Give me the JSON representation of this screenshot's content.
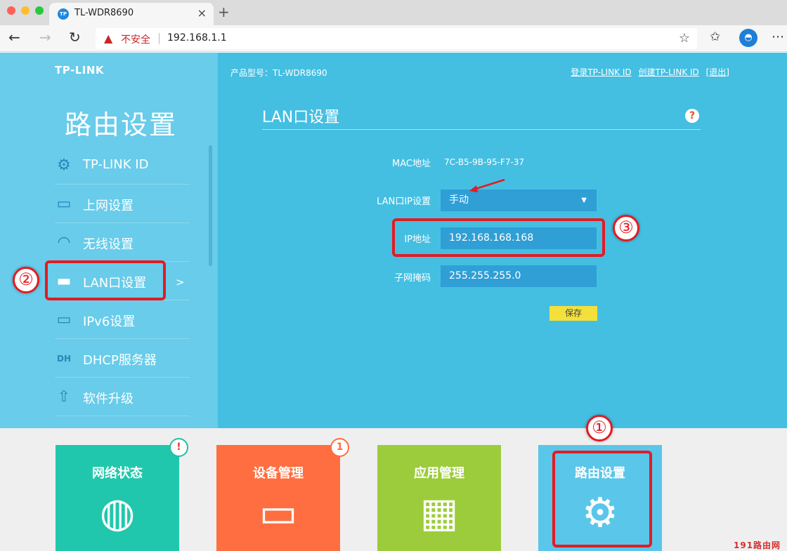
{
  "browser": {
    "tab_title": "TL-WDR8690",
    "tab_favicon": "TP",
    "tab_close": "×",
    "new_tab": "+",
    "insecure_label": "不安全",
    "url": "192.168.1.1",
    "back": "←",
    "forward": "→",
    "reload": "↻",
    "star": "☆",
    "favorites": "✩",
    "more": "⋯"
  },
  "router": {
    "logo": "TP-LINK",
    "model": "产品型号：TL-WDR8690",
    "top_links": [
      "登录TP-LINK ID",
      "创建TP-LINK ID",
      "[退出]"
    ],
    "sidebar_title": "路由设置",
    "menu": [
      {
        "label": "TP-LINK ID",
        "icon": "gear-icon",
        "glyph": "⚙"
      },
      {
        "label": "上网设置",
        "icon": "laptop-icon",
        "glyph": "▭"
      },
      {
        "label": "无线设置",
        "icon": "wifi-icon",
        "glyph": "◠"
      },
      {
        "label": "LAN口设置",
        "icon": "lan-port-icon",
        "glyph": "▬"
      },
      {
        "label": "IPv6设置",
        "icon": "laptop-icon",
        "glyph": "▭"
      },
      {
        "label": "DHCP服务器",
        "icon": "dhcp-icon",
        "glyph": "DH"
      },
      {
        "label": "软件升级",
        "icon": "upload-icon",
        "glyph": "⇧"
      }
    ],
    "menu_arrow": ">",
    "section_title": "LAN口设置",
    "help": "?",
    "form": {
      "mac_label": "MAC地址",
      "mac_value": "7C-B5-9B-95-F7-37",
      "lan_ip_mode_label": "LAN口IP设置",
      "lan_ip_mode_value": "手动",
      "ip_label": "IP地址",
      "ip_value": "192.168.168.168",
      "mask_label": "子网掩码",
      "mask_value": "255.255.255.0",
      "save": "保存"
    }
  },
  "tiles": [
    {
      "label": "网络状态",
      "icon": "globe-icon",
      "glyph": "◍",
      "color": "#21c7ad",
      "badge": "!",
      "badge_color": "#e53935"
    },
    {
      "label": "设备管理",
      "icon": "laptop-wifi-icon",
      "glyph": "▭",
      "color": "#ff6e40",
      "badge": "1",
      "badge_color": "#ff6e40"
    },
    {
      "label": "应用管理",
      "icon": "apps-grid-icon",
      "glyph": "▦",
      "color": "#9ccc3c",
      "badge": "",
      "badge_color": ""
    },
    {
      "label": "路由设置",
      "icon": "gear-icon",
      "glyph": "⚙",
      "color": "#5ac6ea",
      "badge": "",
      "badge_color": ""
    }
  ],
  "annotations": {
    "step1": "①",
    "step2": "②",
    "step3": "③",
    "watermark": "191路由网"
  },
  "colors": {
    "sidebar": "#68ccea",
    "main": "#44bfe2",
    "annotation_red": "#e31b23",
    "save_button": "#f4e03a"
  }
}
